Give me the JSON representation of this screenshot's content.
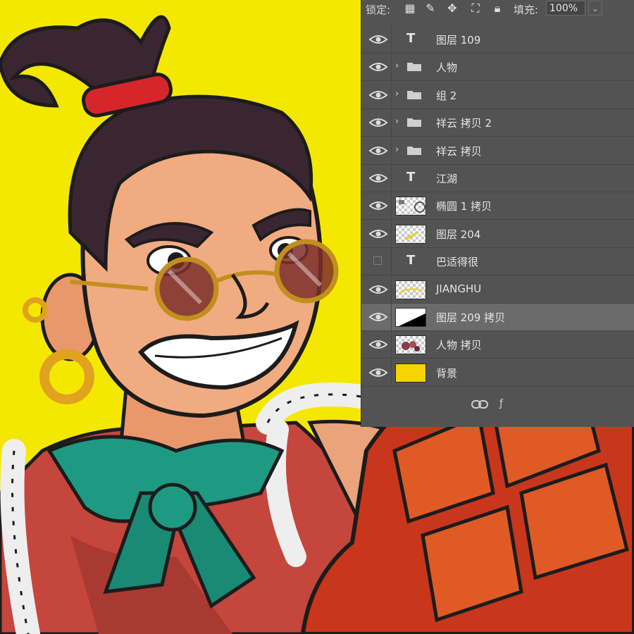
{
  "canvas": {
    "background_color": "#f5e800"
  },
  "layers_panel": {
    "lock_label": "锁定:",
    "fill_label": "填充:",
    "fill_value": "100%",
    "fill_dropdown_symbol": "⌄",
    "layers": [
      {
        "name": "图层 109",
        "kind": "text",
        "icon_glyph": "T",
        "visible": true
      },
      {
        "name": "人物",
        "kind": "group",
        "visible": true
      },
      {
        "name": "组 2",
        "kind": "group",
        "visible": true
      },
      {
        "name": "祥云 拷贝 2",
        "kind": "group",
        "visible": true
      },
      {
        "name": "祥云 拷贝",
        "kind": "group",
        "visible": true
      },
      {
        "name": "江湖",
        "kind": "text",
        "icon_glyph": "T",
        "visible": true
      },
      {
        "name": "椭圆 1 拷贝",
        "kind": "pixel",
        "visible": true
      },
      {
        "name": "图层 204",
        "kind": "pixel",
        "visible": true
      },
      {
        "name": "巴适得很",
        "kind": "text",
        "icon_glyph": "T",
        "visible": false
      },
      {
        "name": "JIANGHU",
        "kind": "pixel",
        "visible": true
      },
      {
        "name": "图层 209 拷贝",
        "kind": "pixel",
        "visible": true,
        "selected": true
      },
      {
        "name": "人物 拷贝",
        "kind": "pixel",
        "visible": true
      },
      {
        "name": "背景",
        "kind": "fill",
        "fill_color": "#f5d400",
        "visible": true
      }
    ],
    "footer_icons": [
      "link-layers-icon",
      "fx-icon"
    ]
  }
}
